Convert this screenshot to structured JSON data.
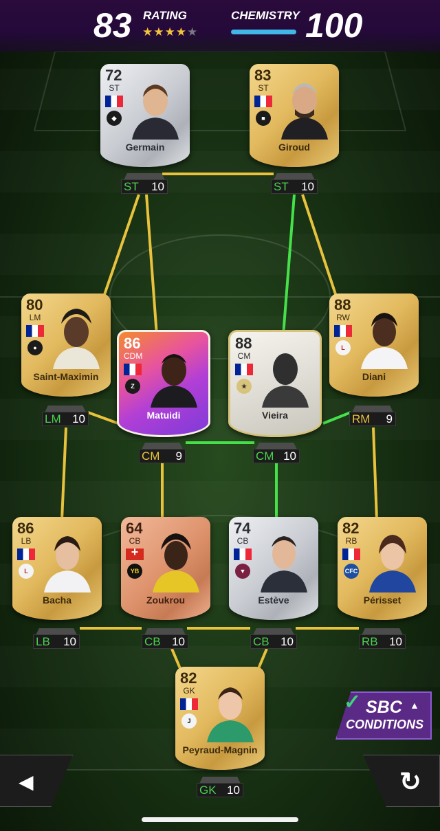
{
  "header": {
    "rating_value": "83",
    "rating_label": "RATING",
    "stars_filled": 4,
    "stars_total": 5,
    "chemistry_label": "CHEMISTRY",
    "chemistry_value": "100"
  },
  "players": {
    "germain": {
      "rating": "72",
      "position": "ST",
      "name": "Germain",
      "card": "silver",
      "nation": "France",
      "badge_pos": "ST",
      "badge_chem": "10"
    },
    "giroud": {
      "rating": "83",
      "position": "ST",
      "name": "Giroud",
      "card": "gold",
      "nation": "France",
      "badge_pos": "ST",
      "badge_chem": "10"
    },
    "saint_maximin": {
      "rating": "80",
      "position": "LM",
      "name": "Saint-Maximin",
      "card": "gold",
      "nation": "France",
      "badge_pos": "LM",
      "badge_chem": "10"
    },
    "matuidi": {
      "rating": "86",
      "position": "CDM",
      "name": "Matuidi",
      "card": "promo",
      "nation": "France",
      "badge_pos": "CM",
      "badge_chem": "9"
    },
    "vieira": {
      "rating": "88",
      "position": "CM",
      "name": "Vieira",
      "card": "icon",
      "nation": "France",
      "badge_pos": "CM",
      "badge_chem": "10"
    },
    "diani": {
      "rating": "88",
      "position": "RW",
      "name": "Diani",
      "card": "gold",
      "nation": "France",
      "badge_pos": "RM",
      "badge_chem": "9"
    },
    "bacha": {
      "rating": "86",
      "position": "LB",
      "name": "Bacha",
      "card": "gold",
      "nation": "France",
      "badge_pos": "LB",
      "badge_chem": "10"
    },
    "zoukrou": {
      "rating": "64",
      "position": "CB",
      "name": "Zoukrou",
      "card": "bronze",
      "nation": "Switzerland",
      "badge_pos": "CB",
      "badge_chem": "10"
    },
    "esteve": {
      "rating": "74",
      "position": "CB",
      "name": "Estève",
      "card": "silver",
      "nation": "France",
      "badge_pos": "CB",
      "badge_chem": "10"
    },
    "perisset": {
      "rating": "82",
      "position": "RB",
      "name": "Périsset",
      "card": "gold",
      "nation": "France",
      "badge_pos": "RB",
      "badge_chem": "10"
    },
    "peyraud_magnin": {
      "rating": "82",
      "position": "GK",
      "name": "Peyraud-Magnin",
      "card": "gold",
      "nation": "France",
      "badge_pos": "GK",
      "badge_chem": "10"
    }
  },
  "sbc_button": {
    "title": "SBC",
    "subtitle": "CONDITIONS"
  },
  "icons": {
    "back": "back-arrow-icon",
    "reset": "reset-icon",
    "check": "check-icon"
  },
  "colors": {
    "link_full": "#46e04a",
    "link_partial": "#e8c23c",
    "header_bg": "#24093a",
    "chem_bar": "#40b7e6",
    "star": "#f3c43a"
  }
}
